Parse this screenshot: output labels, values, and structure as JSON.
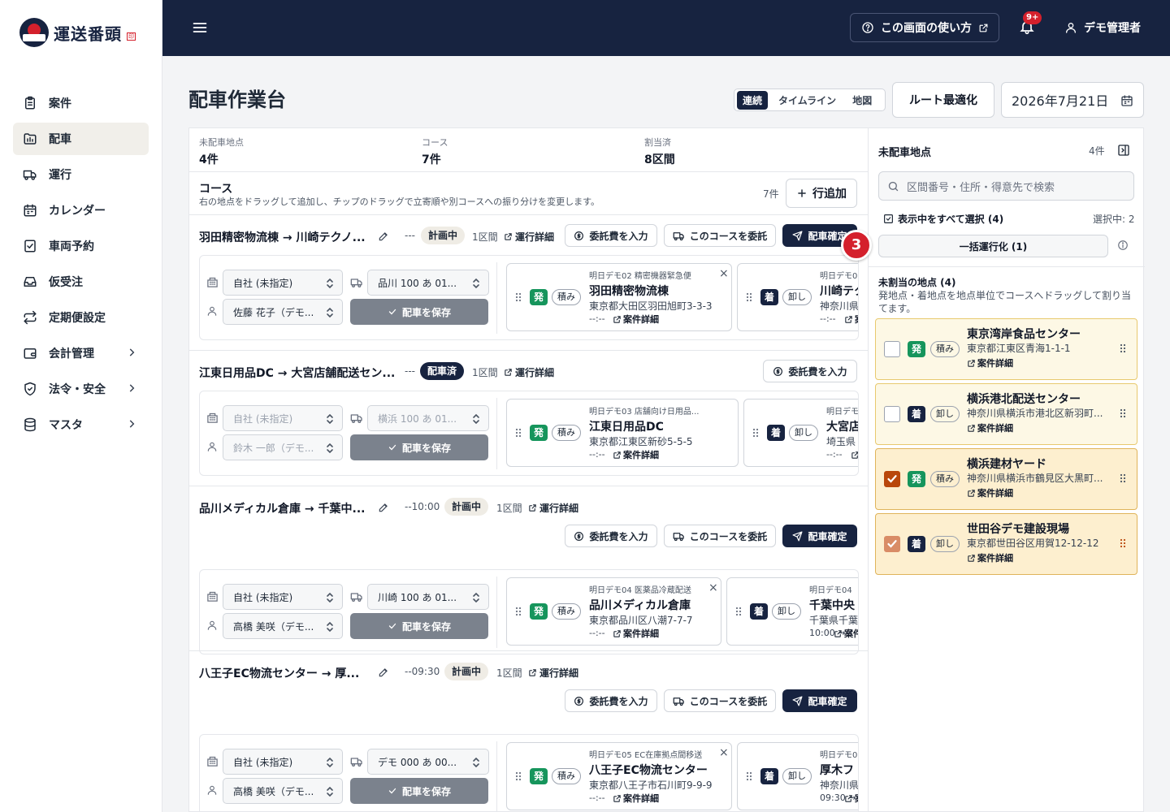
{
  "app": {
    "logo_text": "運送番頭",
    "logo_stamp": "印"
  },
  "sidebar": {
    "items": [
      {
        "label": "案件",
        "icon": "clipboard-icon"
      },
      {
        "label": "配車",
        "icon": "folder-truck-icon",
        "active": true
      },
      {
        "label": "運行",
        "icon": "truck-icon"
      },
      {
        "label": "カレンダー",
        "icon": "calendar-icon"
      },
      {
        "label": "車両予約",
        "icon": "checklist-icon"
      },
      {
        "label": "仮受注",
        "icon": "inbox-icon"
      },
      {
        "label": "定期便設定",
        "icon": "repeat-icon"
      },
      {
        "label": "会計管理",
        "icon": "wallet-icon",
        "has_children": true
      },
      {
        "label": "法令・安全",
        "icon": "shield-icon",
        "has_children": true
      },
      {
        "label": "マスタ",
        "icon": "database-icon",
        "has_children": true
      }
    ]
  },
  "header": {
    "help_label": "この画面の使い方",
    "notification_badge": "9+",
    "user_name": "デモ管理者"
  },
  "page": {
    "title": "配車作業台",
    "view_tabs": [
      "連続",
      "タイムライン",
      "地図"
    ],
    "active_view": "連続",
    "route_button": "ルート最適化",
    "date": "2026年7月21日"
  },
  "stats": [
    {
      "label": "未配車地点",
      "value": "4件"
    },
    {
      "label": "コース",
      "value": "7件"
    },
    {
      "label": "割当済",
      "value": "8区間"
    }
  ],
  "courses_header": {
    "title": "コース",
    "description": "右の地点をドラッグして追加し、チップのドラッグで立寄順や別コースへの振り分けを変更します。",
    "count": "7件",
    "add_label": "行追加"
  },
  "labels": {
    "operation_detail": "運行詳細",
    "fee_input": "委託費を入力",
    "outsource": "このコースを委託",
    "confirm": "配車確定",
    "save": "配車を保存",
    "case_detail": "案件詳細",
    "load": "積み",
    "unload": "卸し",
    "depart": "発",
    "arrive": "着"
  },
  "courses": [
    {
      "title": "羽田精密物流棟 → 川崎テクノ...",
      "time": "---",
      "status": "計画中",
      "sections": "1区間",
      "company": "自社 (未指定)",
      "vehicle": "品川 100 あ 01...",
      "driver": "佐藤 花子（デモ...",
      "stops": [
        {
          "top": "明日デモ02 精密機器緊急便",
          "name": "羽田精密物流棟",
          "addr": "東京都大田区羽田旭町3-3-3",
          "time": "--:--"
        },
        {
          "top": "明日デモ0",
          "name": "川崎テク",
          "addr": "神奈川県",
          "time": "--:--"
        }
      ]
    },
    {
      "title": "江東日用品DC → 大宮店舗配送セン...",
      "time": "---",
      "status": "配車済",
      "sections": "1区間",
      "company": "自社 (未指定)",
      "vehicle": "横浜 100 あ 01...",
      "driver": "鈴木 一郎（デモ...",
      "stops": [
        {
          "top": "明日デモ03 店舗向け日用品...",
          "name": "江東日用品DC",
          "addr": "東京都江東区新砂5-5-5",
          "time": "--:--"
        },
        {
          "top": "明日デモ",
          "name": "大宮店",
          "addr": "埼玉県",
          "time": "--:--"
        }
      ]
    },
    {
      "title": "品川メディカル倉庫 → 千葉中...",
      "time": "--10:00",
      "status": "計画中",
      "sections": "1区間",
      "company": "自社 (未指定)",
      "vehicle": "川崎 100 あ 01...",
      "driver": "高橋 美咲（デモ...",
      "stops": [
        {
          "top": "明日デモ04 医薬品冷蔵配送",
          "name": "品川メディカル倉庫",
          "addr": "東京都品川区八潮7-7-7",
          "time": "--:--"
        },
        {
          "top": "明日デモ04",
          "name": "千葉中央",
          "addr": "千葉県千葉",
          "time": "10:00 → 1"
        }
      ]
    },
    {
      "title": "八王子EC物流センター → 厚...",
      "time": "--09:30",
      "status": "計画中",
      "sections": "1区間",
      "company": "自社 (未指定)",
      "vehicle": "デモ 000 あ 00...",
      "driver": "高橋 美咲（デモ...",
      "stops": [
        {
          "top": "明日デモ05 EC在庫拠点間移送",
          "name": "八王子EC物流センター",
          "addr": "東京都八王子市石川町9-9-9",
          "time": "--:--"
        },
        {
          "top": "明日デモ0",
          "name": "厚木フ",
          "addr": "神奈川県",
          "time": "09:30 →"
        }
      ]
    }
  ],
  "tour_step": "3",
  "right_panel": {
    "title": "未配車地点",
    "count": "4件",
    "search_placeholder": "区間番号・住所・得意先で検索",
    "select_all": "表示中をすべて選択 (4)",
    "selected": "選択中: 2",
    "bulk": "一括運行化 (1)",
    "unassigned_title": "未割当の地点 (4)",
    "unassigned_desc": "発地点・着地点を地点単位でコースへドラッグして割り当てます。",
    "cards": [
      {
        "name": "東京湾岸食品センター",
        "addr": "東京都江東区青海1-1-1",
        "kind": "発",
        "action": "積み",
        "checked": false
      },
      {
        "name": "横浜港北配送センター",
        "addr": "神奈川県横浜市港北区新羽町...",
        "kind": "着",
        "action": "卸し",
        "checked": false
      },
      {
        "name": "横浜建材ヤード",
        "addr": "神奈川県横浜市鶴見区大黒町...",
        "kind": "発",
        "action": "積み",
        "checked": true
      },
      {
        "name": "世田谷デモ建設現場",
        "addr": "東京都世田谷区用賀12-12-12",
        "kind": "着",
        "action": "卸し",
        "checked": true
      }
    ]
  },
  "colors": {
    "navy": "#172340",
    "red": "#d4202c",
    "green": "#16955c",
    "checked": "#b9470b"
  }
}
